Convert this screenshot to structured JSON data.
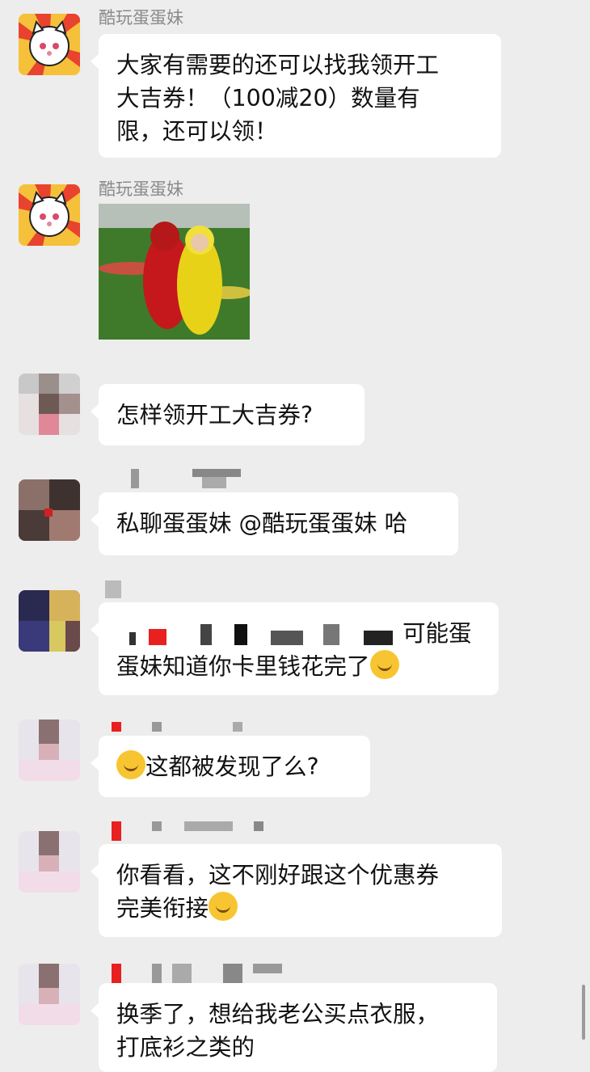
{
  "messages": [
    {
      "sender": "酷玩蛋蛋妹",
      "lines": [
        "大家有需要的还可以找我领开工",
        "大吉券！（100减20）数量有",
        "限，还可以领！"
      ]
    },
    {
      "sender": "酷玩蛋蛋妹",
      "image": "teletubbies-hug-sticker"
    },
    {
      "lines": [
        "怎样领开工大吉券?"
      ]
    },
    {
      "lines": [
        "私聊蛋蛋妹 @酷玩蛋蛋妹 哈"
      ]
    },
    {
      "lines": [
        "可能蛋",
        "蛋妹知道你卡里钱花完了"
      ],
      "emoji": "wink-tongue-emoji"
    },
    {
      "lines": [
        "这都被发现了么?"
      ],
      "emoji": "tears-of-joy-emoji"
    },
    {
      "lines": [
        "你看看，这不刚好跟这个优惠券",
        "完美衔接"
      ],
      "emoji": "666-emoji"
    },
    {
      "lines": [
        "换季了，想给我老公买点衣服，",
        "打底衫之类的"
      ]
    }
  ],
  "colors": {
    "background": "#ededed",
    "bubble": "#ffffff",
    "sender": "#8a8a8a",
    "text": "#111111"
  }
}
